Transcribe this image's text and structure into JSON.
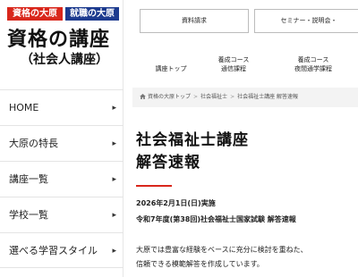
{
  "logo": {
    "badge_red": "資格の大原",
    "badge_blue": "就職の大原",
    "title": "資格の講座",
    "subtitle": "（社会人講座）"
  },
  "sidebar": {
    "items": [
      {
        "label": "HOME",
        "icon": "chevron-right-icon"
      },
      {
        "label": "大原の特長",
        "icon": "chevron-right-icon"
      },
      {
        "label": "講座一覧",
        "icon": "chevron-right-icon"
      },
      {
        "label": "学校一覧",
        "icon": "chevron-right-icon"
      },
      {
        "label": "選べる学習スタイル",
        "icon": "chevron-right-icon"
      }
    ]
  },
  "header": {
    "buttons": [
      "資料請求",
      "セミナー・説明会・"
    ]
  },
  "subnav": {
    "items": [
      {
        "line1": "講座トップ",
        "line2": ""
      },
      {
        "line1": "養成コース",
        "line2": "通信課程"
      },
      {
        "line1": "養成コース",
        "line2": "夜間通学課程"
      }
    ]
  },
  "breadcrumb": {
    "items": [
      "資格の大原トップ",
      "社会福祉士",
      "社会福祉士講座 解答速報"
    ],
    "separator": ">"
  },
  "main": {
    "title_line1": "社会福祉士講座",
    "title_line2": "解答速報",
    "date": "2026年2月1日(日)実施",
    "exam": "令和7年度(第38回)社会福祉士国家試験 解答速報",
    "desc_line1": "大原では豊富な経験をベースに充分に検討を重ねた、",
    "desc_line2": "信頼できる模範解答を作成しています。"
  },
  "colors": {
    "brand_red": "#d9271c",
    "brand_blue": "#1d3b8f",
    "crumb_bg": "#f3f3f3"
  }
}
